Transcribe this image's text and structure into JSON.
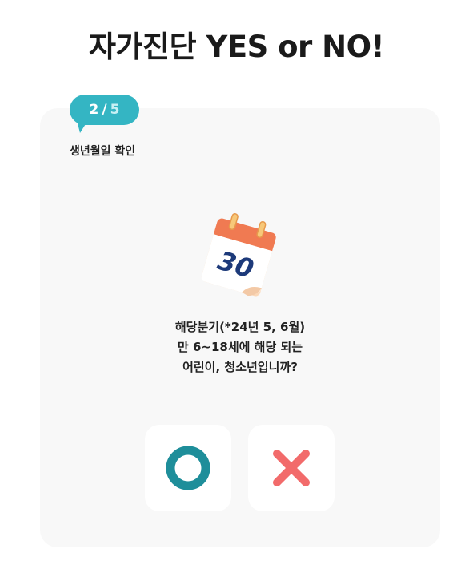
{
  "page": {
    "title": "자가진단 YES or NO!"
  },
  "step": {
    "current": "2",
    "separator": "/",
    "total": "5",
    "label": "생년월일 확인"
  },
  "illustration": {
    "icon": "calendar-icon",
    "day": "30"
  },
  "question": {
    "lines": [
      "해당분기(*24년 5, 6월)",
      "만 6~18세에 해당 되는",
      "어린이, 청소년입니까?"
    ]
  },
  "answers": {
    "yes_icon": "circle-o-icon",
    "no_icon": "cross-x-icon"
  },
  "colors": {
    "accent": "#34b5c3",
    "yes": "#1e8e9a",
    "no": "#f26b6b",
    "card_bg": "#f8f8f8"
  }
}
